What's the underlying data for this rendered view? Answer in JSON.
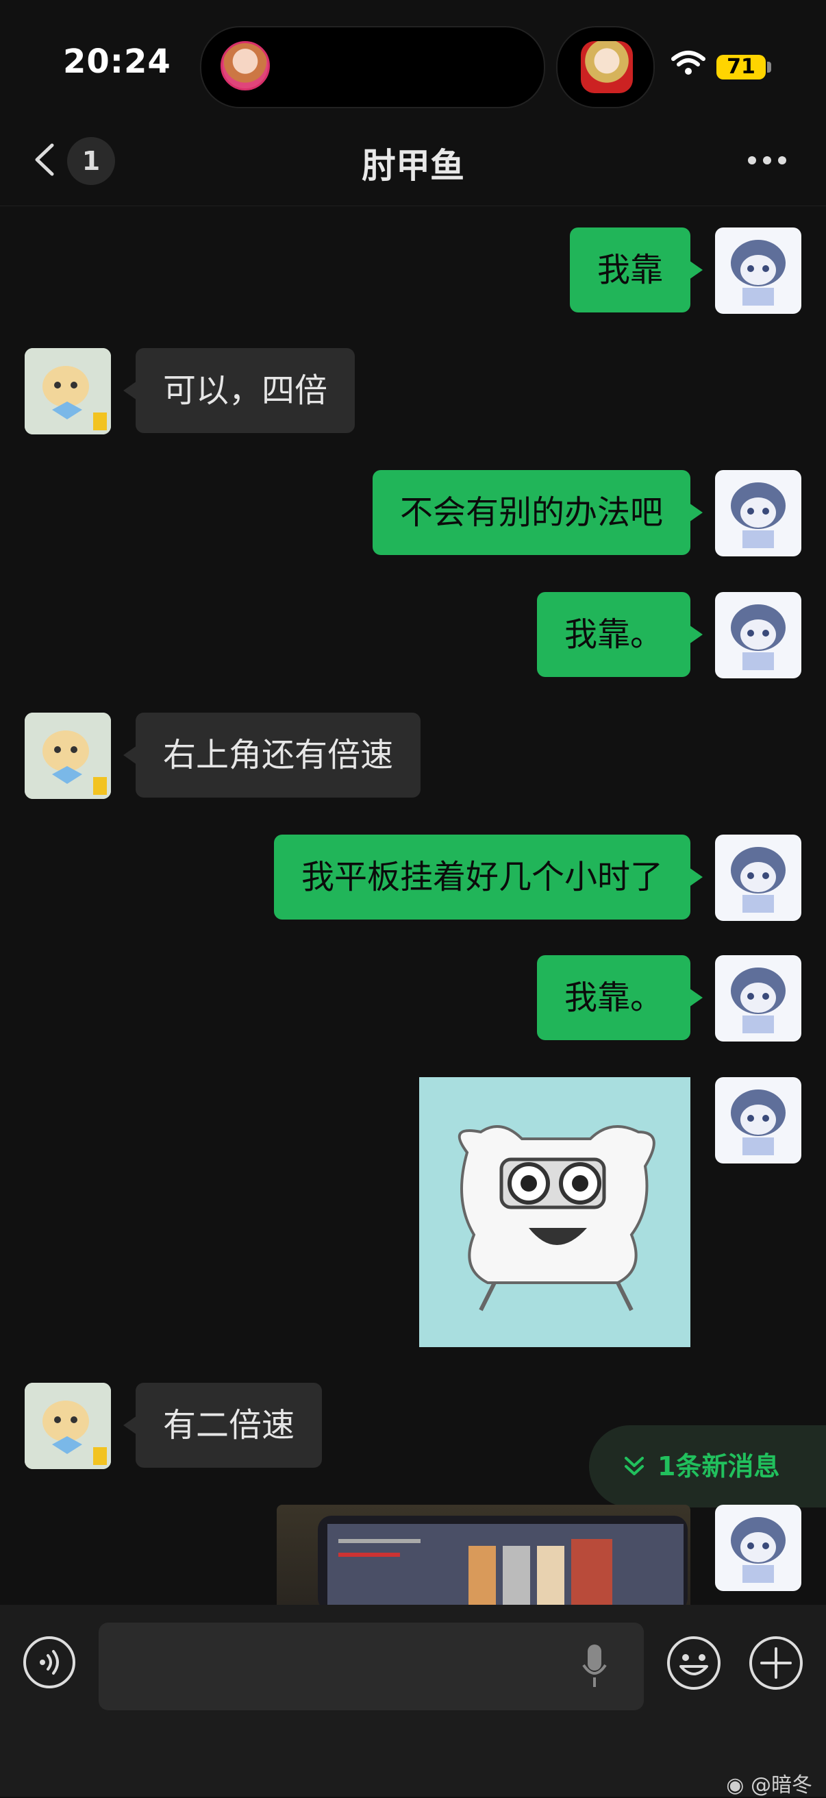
{
  "status_bar": {
    "time": "20:24",
    "battery": "71"
  },
  "header": {
    "unread_count": "1",
    "title": "肘甲鱼"
  },
  "messages": [
    {
      "side": "me",
      "text": "我靠"
    },
    {
      "side": "other",
      "text": "可以，四倍"
    },
    {
      "side": "me",
      "text": "不会有别的办法吧"
    },
    {
      "side": "me",
      "text": "我靠。"
    },
    {
      "side": "other",
      "text": "右上角还有倍速"
    },
    {
      "side": "me",
      "text": "我平板挂着好几个小时了"
    },
    {
      "side": "me",
      "text": "我靠。"
    },
    {
      "side": "me",
      "type": "sticker"
    },
    {
      "side": "other",
      "text": "有二倍速"
    },
    {
      "side": "me",
      "type": "photo"
    }
  ],
  "new_message_banner": "1条新消息",
  "input_bar": {
    "placeholder": ""
  },
  "watermark": "@暗冬",
  "icons": [
    "back-icon",
    "more-icon",
    "wifi-icon",
    "voice-icon",
    "mic-icon",
    "emoji-icon",
    "plus-icon",
    "chevron-double-down-icon",
    "weibo-icon"
  ],
  "colors": {
    "my_bubble": "#21b559",
    "other_bubble": "#2c2c2c",
    "background": "#111111",
    "accent": "#21c05d"
  }
}
